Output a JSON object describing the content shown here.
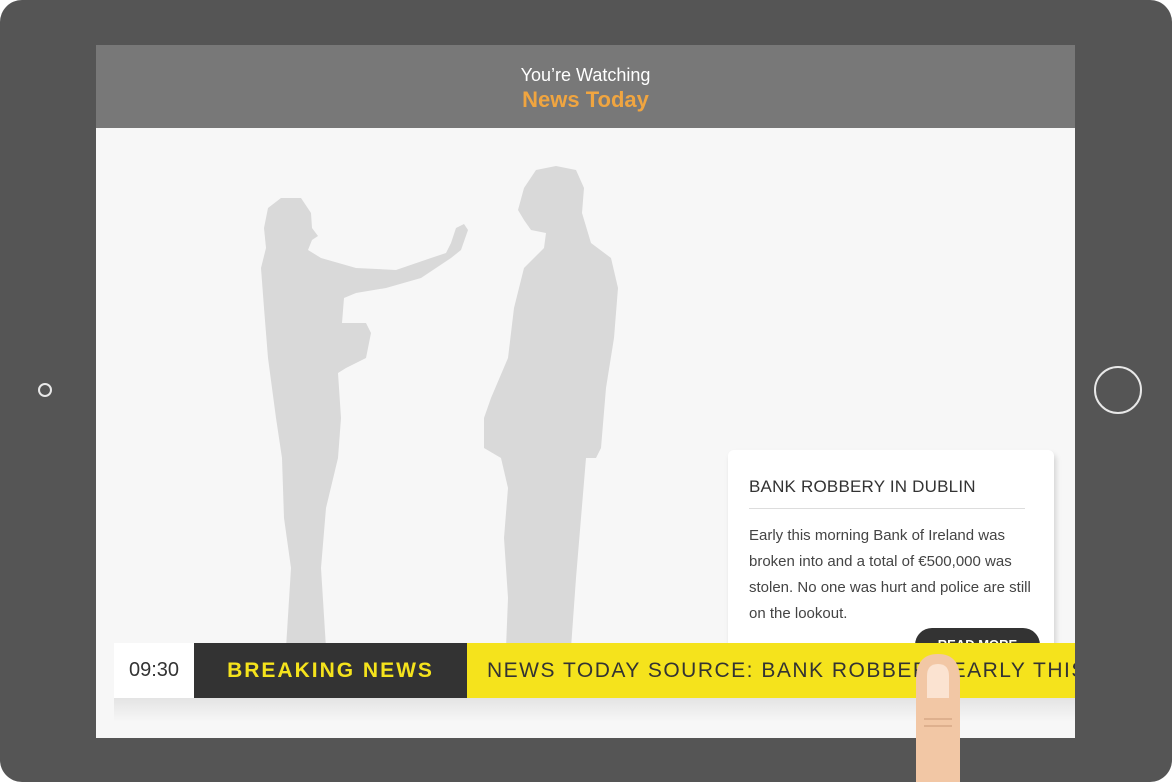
{
  "header": {
    "subtitle": "You’re Watching",
    "title": "News Today"
  },
  "story_popup": {
    "headline": "BANK ROBBERY IN DUBLIN",
    "body": "Early this morning Bank of Ireland was broken into and a total of €500,000 was stolen. No one was hurt and police are still on the lookout.",
    "read_more_label": "READ MORE"
  },
  "ticker": {
    "time": "09:30",
    "label": "BREAKING NEWS",
    "scroll_text": "NEWS TODAY SOURCE: BANK ROBBERY EARLY THIS MORNING"
  },
  "colors": {
    "device": "#555555",
    "header_bar": "#787878",
    "accent_orange": "#f0a540",
    "ticker_yellow": "#f5e31c",
    "dark": "#333333"
  }
}
